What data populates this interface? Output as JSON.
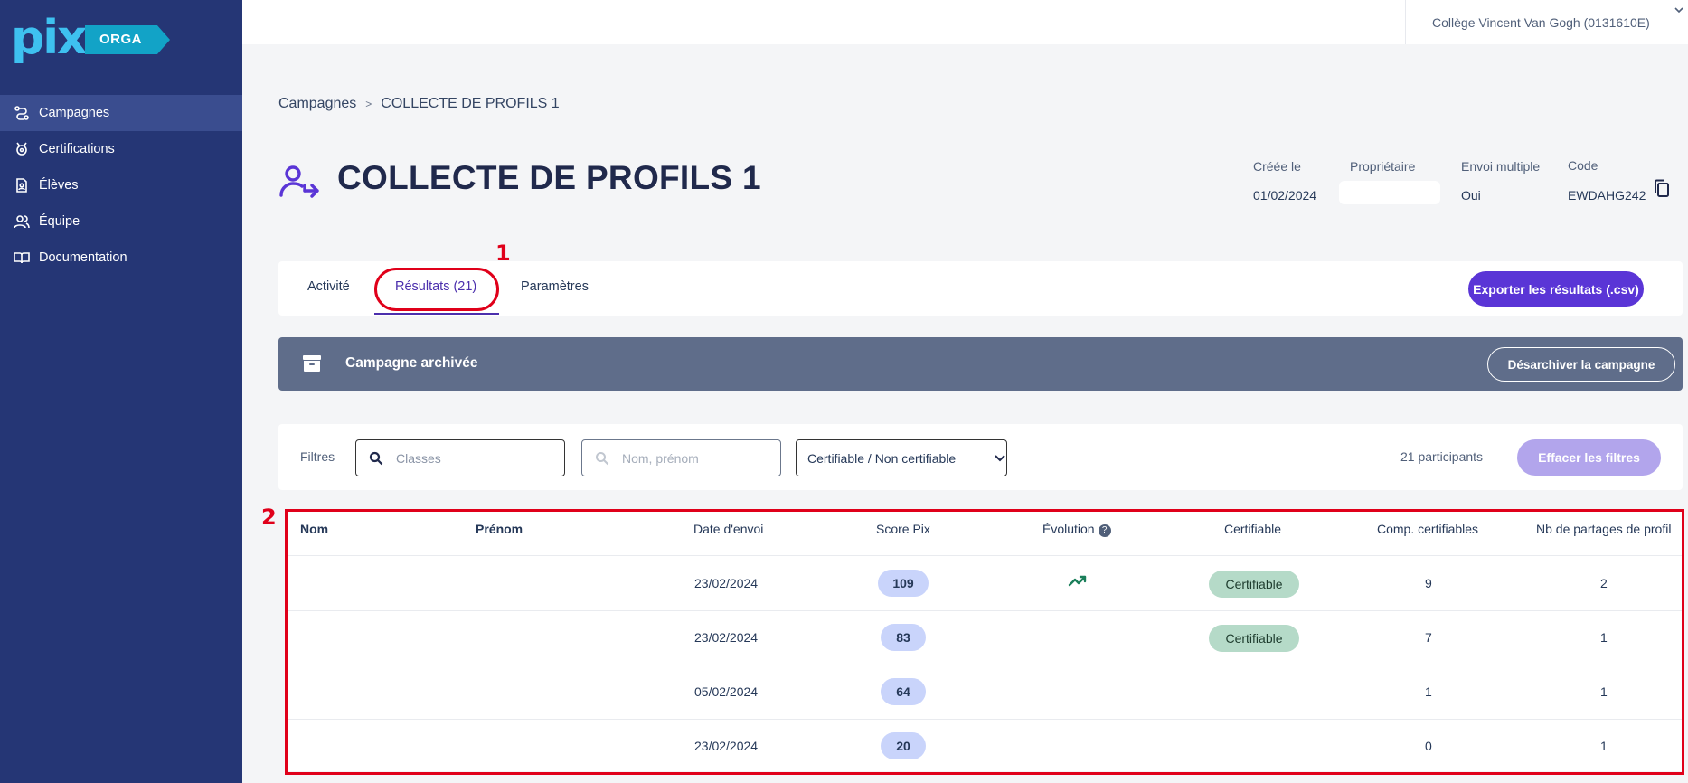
{
  "app": {
    "logo_text": "pix",
    "logo_badge": "ORGA"
  },
  "sidebar": {
    "items": [
      {
        "label": "Campagnes",
        "icon": "campaign-icon",
        "active": true
      },
      {
        "label": "Certifications",
        "icon": "certification-icon",
        "active": false
      },
      {
        "label": "Élèves",
        "icon": "students-icon",
        "active": false
      },
      {
        "label": "Équipe",
        "icon": "team-icon",
        "active": false
      },
      {
        "label": "Documentation",
        "icon": "book-icon",
        "active": false
      }
    ]
  },
  "topbar": {
    "organization": "Collège Vincent Van Gogh (0131610E)"
  },
  "breadcrumb": {
    "root": "Campagnes",
    "separator": ">",
    "current": "COLLECTE DE PROFILS 1"
  },
  "page": {
    "title": "COLLECTE DE PROFILS 1"
  },
  "meta": {
    "created_label": "Créée le",
    "created_value": "01/02/2024",
    "owner_label": "Propriétaire",
    "owner_value": "",
    "multiple_label": "Envoi multiple",
    "multiple_value": "Oui",
    "code_label": "Code",
    "code_value": "EWDAHG242"
  },
  "tabs": [
    {
      "label": "Activité",
      "active": false
    },
    {
      "label": "Résultats (21)",
      "active": true
    },
    {
      "label": "Paramètres",
      "active": false
    }
  ],
  "export_button": "Exporter les résultats (.csv)",
  "archived": {
    "text": "Campagne archivée",
    "button": "Désarchiver la campagne"
  },
  "filters": {
    "label": "Filtres",
    "classes_placeholder": "Classes",
    "name_placeholder": "Nom, prénom",
    "certifiable_select": "Certifiable / Non certifiable",
    "participants": "21 participants",
    "clear_button": "Effacer les filtres"
  },
  "table": {
    "headers": [
      "Nom",
      "Prénom",
      "Date d'envoi",
      "Score Pix",
      "Évolution",
      "Certifiable",
      "Comp. certifiables",
      "Nb de partages de profil"
    ],
    "rows": [
      {
        "nom": "",
        "prenom": "",
        "date": "23/02/2024",
        "score": "109",
        "evolution": "increase",
        "certifiable": "Certifiable",
        "comp": "9",
        "partages": "2"
      },
      {
        "nom": "",
        "prenom": "",
        "date": "23/02/2024",
        "score": "83",
        "evolution": "",
        "certifiable": "Certifiable",
        "comp": "7",
        "partages": "1"
      },
      {
        "nom": "",
        "prenom": "",
        "date": "05/02/2024",
        "score": "64",
        "evolution": "",
        "certifiable": "",
        "comp": "1",
        "partages": "1"
      },
      {
        "nom": "",
        "prenom": "",
        "date": "23/02/2024",
        "score": "20",
        "evolution": "",
        "certifiable": "",
        "comp": "0",
        "partages": "1"
      }
    ]
  },
  "annotations": {
    "label_1": "1",
    "label_2": "2"
  },
  "colors": {
    "sidebar": "#253675",
    "primary": "#5a35d6",
    "archived": "#5f6d8a",
    "annotation": "#e0001a"
  }
}
